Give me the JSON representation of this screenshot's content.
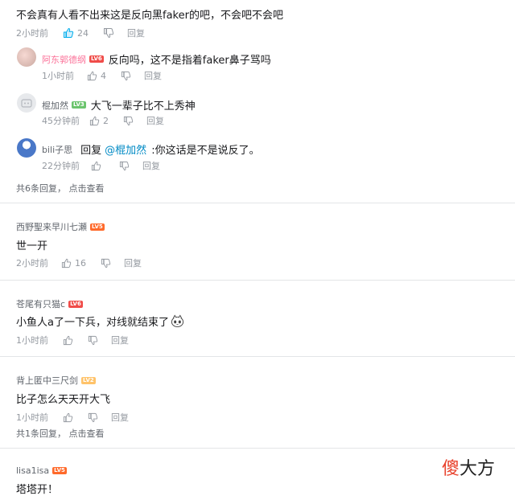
{
  "comments": {
    "top": {
      "text": "不会真有人看不出来这是反向黑faker的吧，不会吧不会吧",
      "time": "2小时前",
      "likes": "24",
      "reply_label": "回复"
    },
    "replies": [
      {
        "user": "阿东郭德纲",
        "level": "LV6",
        "text": "反向吗，这不是指着faker鼻子骂吗",
        "time": "1小时前",
        "likes": "4",
        "reply_label": "回复"
      },
      {
        "user": "棍加然",
        "level": "LV3",
        "text": "大飞一辈子比不上秀神",
        "time": "45分钟前",
        "likes": "2",
        "reply_label": "回复"
      },
      {
        "user": "bili子思",
        "reply_prefix": "回复",
        "mention": "@棍加然",
        "text": ":你这话是不是说反了。",
        "time": "22分钟前",
        "reply_label": "回复"
      }
    ],
    "replies_summary": {
      "count_text": "共6条回复，",
      "action": "点击查看"
    },
    "second": {
      "user": "西野聖来早川七瀬",
      "level": "LV5",
      "text": "世一开",
      "time": "2小时前",
      "likes": "16",
      "reply_label": "回复"
    },
    "third": {
      "user": "苍尾有只猫c",
      "level": "LV6",
      "text": "小鱼人a了一下兵，对线就结束了",
      "time": "1小时前",
      "reply_label": "回复"
    },
    "fourth": {
      "user": "背上匿中三尺剑",
      "level": "LV2",
      "text": "比子怎么天天开大飞",
      "time": "1小时前",
      "reply_label": "回复"
    },
    "fourth_summary": {
      "count_text": "共1条回复，",
      "action": "点击查看"
    },
    "fifth": {
      "user": "lisa1isa",
      "level": "LV5",
      "text": "塔塔开！"
    }
  },
  "watermark": {
    "part1": "傻",
    "part2": "大方"
  },
  "colors": {
    "brand_pink": "#fb7299",
    "link_blue": "#008ac5",
    "meta_gray": "#9499a0"
  },
  "icons": {
    "like": "thumb-up-icon",
    "dislike": "thumb-down-icon",
    "emoji": "emoji-face-icon"
  }
}
